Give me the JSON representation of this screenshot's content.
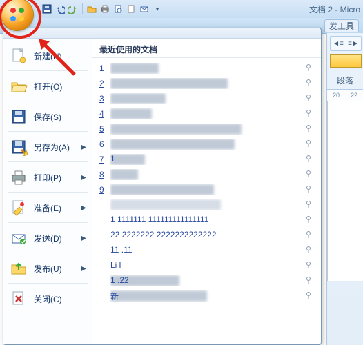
{
  "title": "文档 2 - Micro",
  "visible_tab": "发工具",
  "qat_icons": [
    "save-icon",
    "undo-icon",
    "redo-icon",
    "open-icon",
    "quickprint-icon",
    "preview-icon",
    "new-icon",
    "email-icon"
  ],
  "ribbon": {
    "group_label": "段落",
    "ruler_marks": [
      "20",
      "22"
    ]
  },
  "office_menu": {
    "left": [
      {
        "icon": "new-doc-icon",
        "label": "新建(N)",
        "arrow": false
      },
      {
        "icon": "folder-open-icon",
        "label": "打开(O)",
        "arrow": false
      },
      {
        "icon": "save-disk-icon",
        "label": "保存(S)",
        "arrow": false
      },
      {
        "icon": "save-as-icon",
        "label": "另存为(A)",
        "arrow": true
      },
      {
        "icon": "printer-icon",
        "label": "打印(P)",
        "arrow": true
      },
      {
        "icon": "prepare-icon",
        "label": "准备(E)",
        "arrow": true
      },
      {
        "icon": "send-mail-icon",
        "label": "发送(D)",
        "arrow": true
      },
      {
        "icon": "publish-icon",
        "label": "发布(U)",
        "arrow": true
      },
      {
        "icon": "close-doc-icon",
        "label": "关闭(C)",
        "arrow": false
      }
    ],
    "recent_header": "最近使用的文档",
    "recent": [
      {
        "num": "1",
        "text": "",
        "blur_w": 70
      },
      {
        "num": "2",
        "text": "",
        "blur_w": 170
      },
      {
        "num": "3",
        "text": "",
        "blur_w": 80
      },
      {
        "num": "4",
        "text": "",
        "blur_w": 60
      },
      {
        "num": "5",
        "text": "",
        "blur_w": 190
      },
      {
        "num": "6",
        "text": "",
        "blur_w": 180
      },
      {
        "num": "7",
        "text": "1",
        "blur_w": 50
      },
      {
        "num": "8",
        "text": "",
        "blur_w": 40
      },
      {
        "num": "9",
        "text": "",
        "blur_w": 150
      },
      {
        "num": "",
        "text": "",
        "blur_w": 160,
        "lite": true
      },
      {
        "num": "",
        "text": "1     1111111    111111111111111",
        "blur_w": 0
      },
      {
        "num": "",
        "text": "22       2222222   2222222222222",
        "blur_w": 0
      },
      {
        "num": "",
        "text": "11  .11",
        "blur_w": 0
      },
      {
        "num": "",
        "text": "Li    l",
        "blur_w": 0
      },
      {
        "num": "",
        "text": "1   .22     ",
        "blur_w": 100
      },
      {
        "num": "",
        "text": "新",
        "blur_w": 140
      }
    ]
  }
}
